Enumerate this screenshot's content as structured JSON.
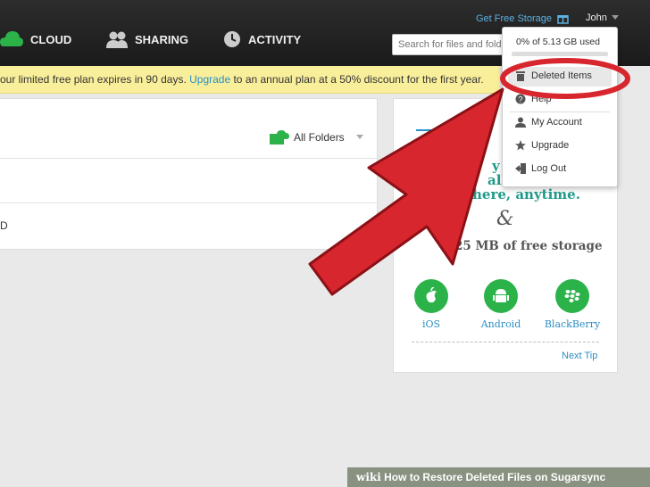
{
  "topbar": {
    "nav": [
      {
        "label": "CLOUD",
        "icon": "cloud-icon"
      },
      {
        "label": "SHARING",
        "icon": "users-icon"
      },
      {
        "label": "ACTIVITY",
        "icon": "clock-icon"
      }
    ],
    "search_placeholder": "Search for files and folders",
    "get_free_storage": "Get Free Storage",
    "user_name": "John"
  },
  "banner": {
    "prefix": "our limited free plan expires in 90 days. ",
    "link": "Upgrade",
    "suffix": " to an annual plan at a 50% discount for the first year."
  },
  "main": {
    "folder_filter": "All Folders",
    "row_text": "D"
  },
  "promo": {
    "line1": "y",
    "line2": "all",
    "line3": "here, anytime.",
    "ampersand": "&",
    "storage": "25 MB of free storage",
    "platforms": [
      {
        "label": "iOS",
        "icon": "apple-icon"
      },
      {
        "label": "Android",
        "icon": "android-icon"
      },
      {
        "label": "BlackBerry",
        "icon": "blackberry-icon"
      }
    ],
    "next_tip": "Next Tip"
  },
  "dropdown": {
    "usage": "0% of 5.13 GB used",
    "items": [
      {
        "label": "Deleted Items",
        "icon": "trash-icon"
      },
      {
        "label": "Help",
        "icon": "help-icon"
      },
      {
        "label": "My Account",
        "icon": "person-icon"
      },
      {
        "label": "Upgrade",
        "icon": "star-icon"
      },
      {
        "label": "Log Out",
        "icon": "logout-icon"
      }
    ]
  },
  "footer": {
    "brand": "wiki",
    "title": "How to Restore Deleted Files on Sugarsync"
  },
  "colors": {
    "annotation_red": "#d8262e",
    "brand_green": "#2bb34a",
    "link_blue": "#2a8ec4"
  }
}
